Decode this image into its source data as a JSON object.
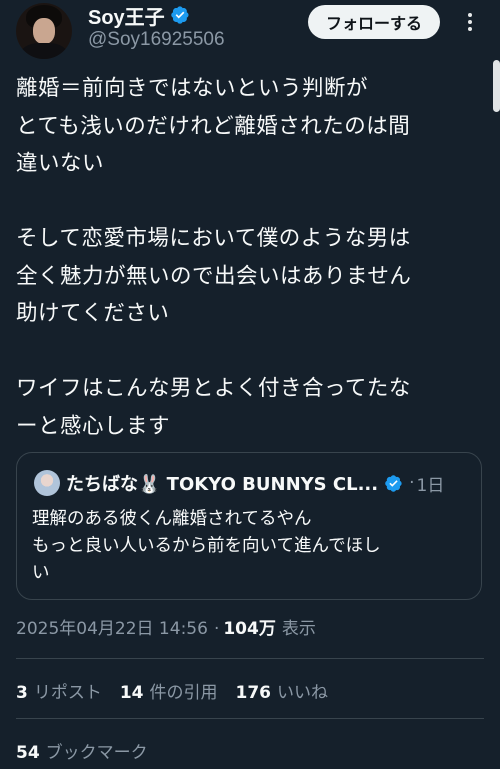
{
  "author": {
    "display_name": "Soy王子",
    "handle": "@Soy16925506",
    "verified": true
  },
  "header": {
    "follow_label": "フォローする",
    "more_icon": "more-vertical-icon"
  },
  "tweet": {
    "paragraphs": [
      "離婚＝前向きではないという判断が\nとても浅いのだけれど離婚されたのは間\n違いない",
      "そして恋愛市場において僕のような男は\n全く魅力が無いので出会いはありません\n助けてください",
      "ワイフはこんな男とよく付き合ってたな\nーと感心します"
    ]
  },
  "quote": {
    "author_name": "たちばな🐰 TOKYO BUNNYS CL...",
    "verified": true,
    "dot": "·",
    "time": "1日",
    "text": "理解のある彼くん離婚されてるやん\nもっと良い人いるから前を向いて進んでほし\nい"
  },
  "meta": {
    "timestamp": "2025年04月22日 14:56",
    "dot": "·",
    "views": "104万",
    "views_label": "表示"
  },
  "stats": {
    "reposts_count": "3",
    "reposts_label": "リポスト",
    "quotes_count": "14",
    "quotes_label": "件の引用",
    "likes_count": "176",
    "likes_label": "いいね",
    "bookmarks_count": "54",
    "bookmarks_label": "ブックマーク"
  },
  "colors": {
    "background": "#15202b",
    "text": "#f7f9f9",
    "secondary": "#8b98a5",
    "verified": "#1d9bf0",
    "border": "#38444d"
  }
}
